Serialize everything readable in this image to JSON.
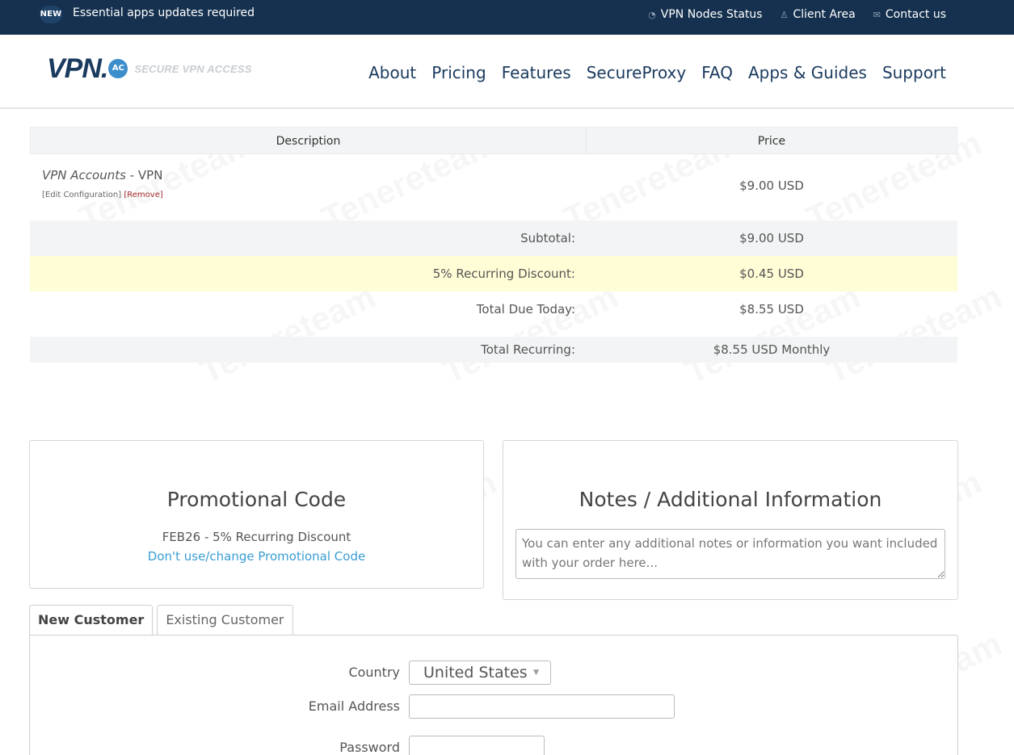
{
  "topbar": {
    "badge": "NEW",
    "message": "Essential apps updates required",
    "links": [
      {
        "icon": "signal-icon",
        "glyph": "◔",
        "label": "VPN Nodes Status"
      },
      {
        "icon": "user-icon",
        "glyph": "♙",
        "label": "Client Area"
      },
      {
        "icon": "mail-icon",
        "glyph": "✉",
        "label": "Contact us"
      }
    ]
  },
  "header": {
    "logo_text": "VPN.",
    "logo_badge": "AC",
    "logo_tagline": "SECURE VPN ACCESS",
    "nav": [
      "About",
      "Pricing",
      "Features",
      "SecureProxy",
      "FAQ",
      "Apps & Guides",
      "Support"
    ]
  },
  "summary": {
    "col_description": "Description",
    "col_price": "Price",
    "item": {
      "product_italic": "VPN Accounts",
      "product_rest": " - VPN",
      "edit_link": "[Edit Configuration]",
      "remove_link": "[Remove]",
      "price": "$9.00 USD"
    },
    "subtotal_label": "Subtotal:",
    "subtotal_value": "$9.00 USD",
    "discount_label": "5% Recurring Discount:",
    "discount_value": "$0.45 USD",
    "total_label": "Total Due Today:",
    "total_value": "$8.55 USD",
    "recurring_label": "Total Recurring:",
    "recurring_value": "$8.55 USD Monthly"
  },
  "promo": {
    "title": "Promotional Code",
    "applied": "FEB26 - 5% Recurring Discount",
    "change_link": "Don't use/change Promotional Code"
  },
  "notes": {
    "title": "Notes / Additional Information",
    "placeholder": "You can enter any additional notes or information you want included with your order here..."
  },
  "customer": {
    "tab_new": "New Customer",
    "tab_existing": "Existing Customer",
    "country_label": "Country",
    "country_value": "United States",
    "email_label": "Email Address",
    "password_label": "Password"
  },
  "watermark": "Tenereteam"
}
